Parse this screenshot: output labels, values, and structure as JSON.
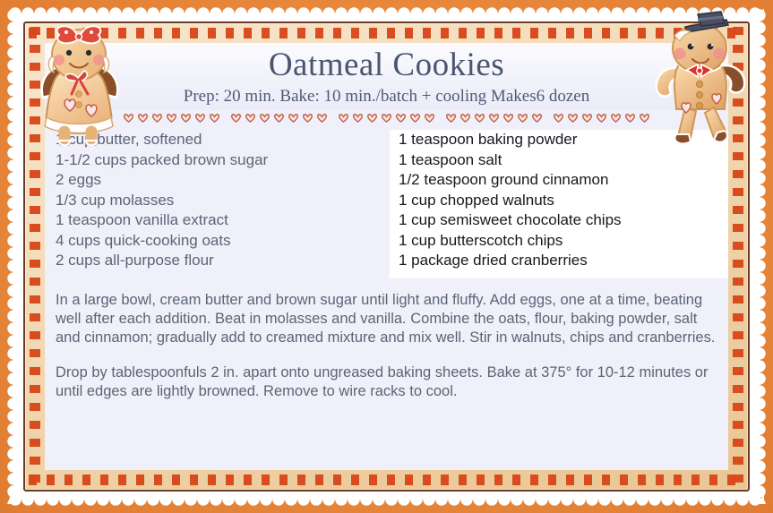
{
  "card": {
    "title": "Oatmeal Cookies",
    "meta": "Prep: 20 min. Bake: 10 min./batch + cooling  Makes6 dozen",
    "colors": {
      "background_orange": "#e8883c",
      "border_dot_red": "#d9471a",
      "border_frame_brown": "#6b3a22",
      "band_tan": "#f3dcb9",
      "panel_lavender": "#f0f0fa",
      "panel_white": "#ffffff",
      "title_text": "#4a5570",
      "body_text": "#5b6477",
      "right_column_text": "#16181c",
      "heart_outline": "#c0634a"
    }
  },
  "ingredients": {
    "left": [
      "1 cup butter, softened",
      "1-1/2 cups packed brown sugar",
      "2 eggs",
      "1/3 cup molasses",
      "1 teaspoon vanilla extract",
      "4 cups quick-cooking oats",
      "2 cups all-purpose flour"
    ],
    "right": [
      "1 teaspoon baking powder",
      "1 teaspoon salt",
      "1/2 teaspoon ground cinnamon",
      "1 cup chopped walnuts",
      "1 cup semisweet chocolate chips",
      "1 cup butterscotch chips",
      "1 package dried cranberries"
    ]
  },
  "directions": [
    "In a large bowl, cream butter and brown sugar until light and fluffy. Add eggs, one at a time, beating well after each addition. Beat in molasses and vanilla. Combine the oats, flour, baking powder, salt and cinnamon; gradually add to creamed mixture and mix well. Stir in walnuts, chips and cranberries.",
    "Drop by tablespoonfuls 2 in. apart onto ungreased baking sheets. Bake at 375° for 10-12 minutes or until edges are lightly browned. Remove to wire racks to cool."
  ],
  "decorations": {
    "heart_groups": 5,
    "hearts_per_group": 7,
    "gingerbread_girl": "gingerbread-girl-icon",
    "gingerbread_boy": "gingerbread-boy-icon"
  }
}
